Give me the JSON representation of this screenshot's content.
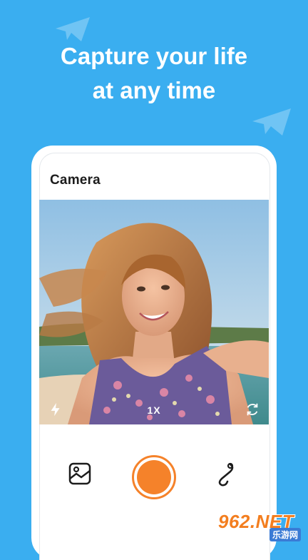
{
  "headline": {
    "line1": "Capture your life",
    "line2": "at any time"
  },
  "screen": {
    "title": "Camera"
  },
  "viewfinder": {
    "zoom_label": "1X",
    "flash_icon": "flash-icon",
    "flip_icon": "flip-camera-icon"
  },
  "controls": {
    "gallery_icon": "gallery-icon",
    "shutter_icon": "shutter-button",
    "effects_icon": "effects-icon"
  },
  "watermark": {
    "main": "962.NET",
    "sub": "乐游网"
  },
  "colors": {
    "background": "#3aaef0",
    "accent": "#f5822a",
    "text": "#1c1c1c"
  }
}
